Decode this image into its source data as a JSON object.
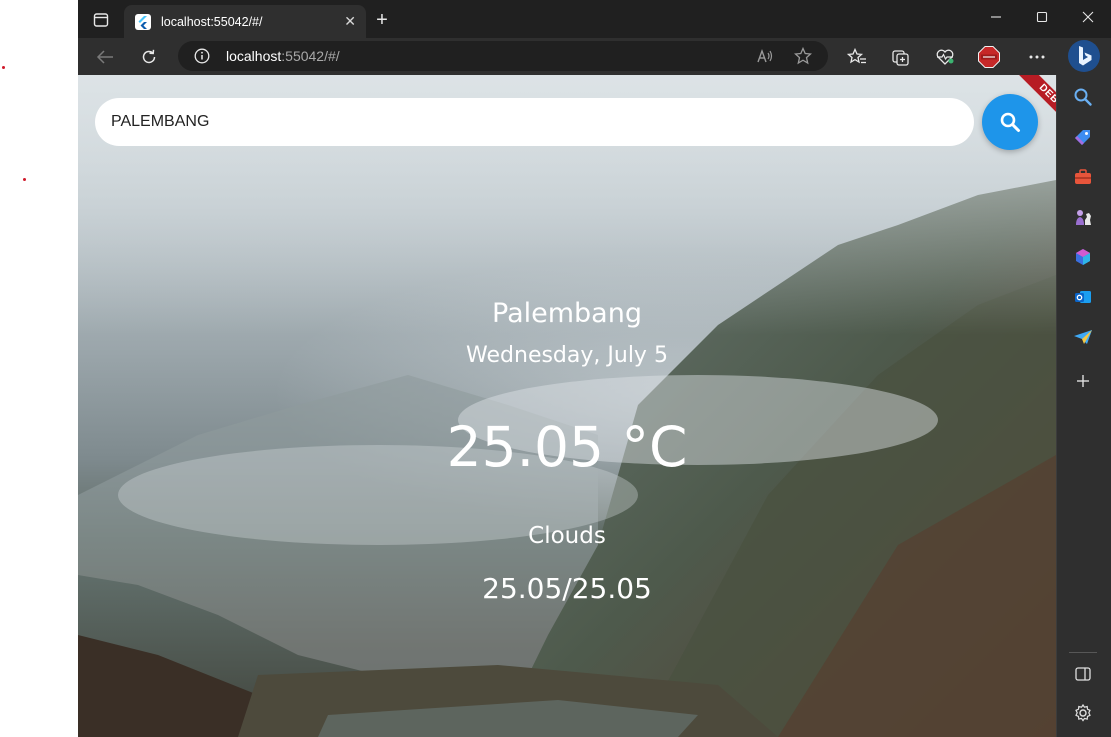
{
  "browser": {
    "tab_title": "localhost:55042/#/",
    "address": {
      "host": "localhost",
      "rest": ":55042/#/"
    }
  },
  "app": {
    "search": {
      "value": "PALEMBANG"
    },
    "debug_banner": "DEBUG",
    "weather": {
      "city": "Palembang",
      "date": "Wednesday, July 5",
      "temperature": "25.05 °C",
      "condition": "Clouds",
      "min_max": "25.05/25.05"
    }
  },
  "colors": {
    "accent_fab": "#1e95ea",
    "debug_banner": "#b71c24",
    "chrome_dark": "#202020",
    "chrome_toolbar": "#2f2f2f"
  },
  "icons": {
    "tab_actions": "tab-actions-icon",
    "favicon": "flutter-favicon-icon",
    "back": "back-arrow-icon",
    "refresh": "refresh-icon",
    "site_info": "info-icon",
    "read_aloud": "read-aloud-icon",
    "favorite": "star-icon",
    "favorites": "favorites-icon",
    "collections": "collections-icon",
    "browser_essentials": "heart-pulse-icon",
    "extension": "stop-extension-icon",
    "more": "more-icon",
    "bing_chat": "bing-icon",
    "search": "search-icon"
  }
}
